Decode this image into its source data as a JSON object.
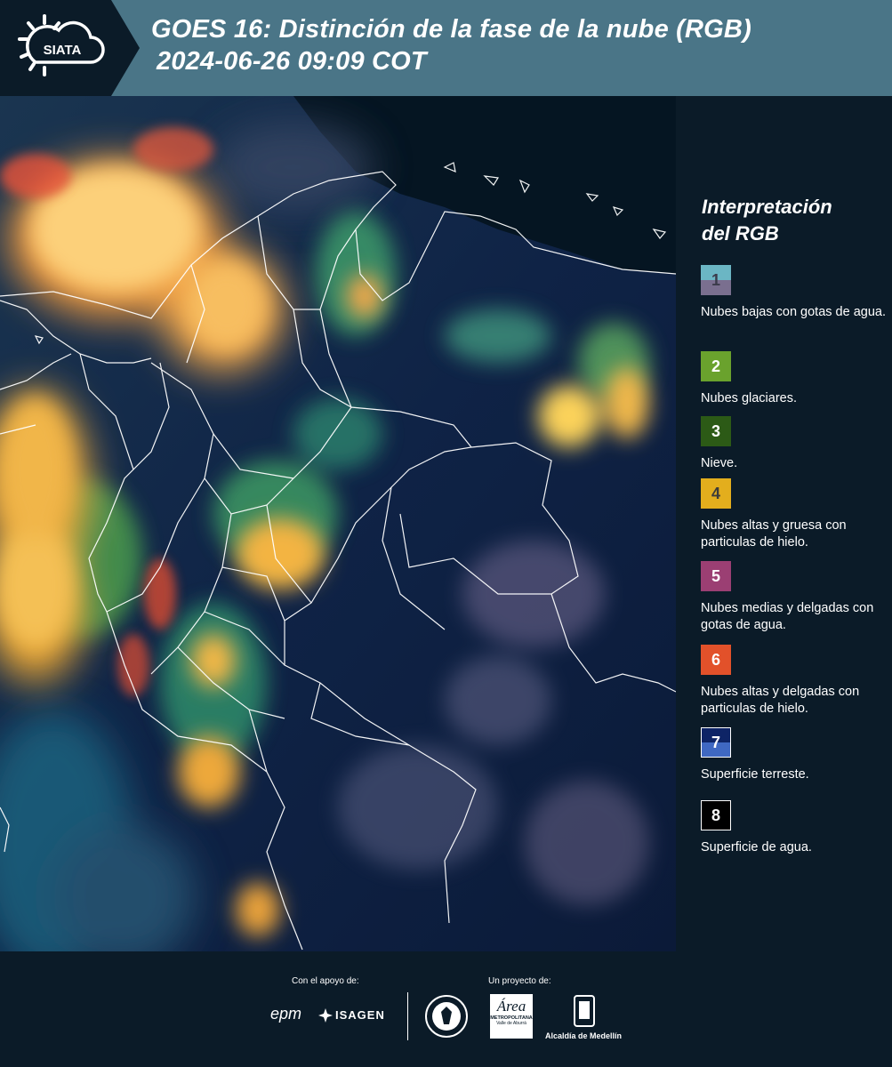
{
  "header": {
    "logo_text": "SIATA",
    "title_line1": "GOES 16: Distinción de la fase de la nube (RGB)",
    "title_line2": "2024-06-26 09:09 COT"
  },
  "legend": {
    "title_line1": "Interpretación",
    "title_line2": "del RGB",
    "items": [
      {
        "number": "1",
        "label": "Nubes bajas con gotas de agua.",
        "color_top": "#6bb6c4",
        "color_bottom": "#7a6f8f",
        "text_color": "#3b3b4a"
      },
      {
        "number": "2",
        "label": "Nubes glaciares.",
        "color_top": "#6aa22d",
        "color_bottom": "#6aa22d",
        "text_color": "#ffffff"
      },
      {
        "number": "3",
        "label": "Nieve.",
        "color_top": "#2c5a16",
        "color_bottom": "#2c5a16",
        "text_color": "#ffffff"
      },
      {
        "number": "4",
        "label": "Nubes altas y gruesa con particulas de hielo.",
        "color_top": "#e3ae1d",
        "color_bottom": "#e3ae1d",
        "text_color": "#3b3b3b"
      },
      {
        "number": "5",
        "label": "Nubes medias y delgadas con gotas de agua.",
        "color_top": "#9b3f73",
        "color_bottom": "#9b3f73",
        "text_color": "#ffffff"
      },
      {
        "number": "6",
        "label": "Nubes altas y delgadas con particulas de hielo.",
        "color_top": "#e2512a",
        "color_bottom": "#e2512a",
        "text_color": "#ffffff"
      },
      {
        "number": "7",
        "label": "Superficie terreste.",
        "color_top": "#0e2466",
        "color_bottom": "#3f68c2",
        "text_color": "#ffffff"
      },
      {
        "number": "8",
        "label": "Superficie de agua.",
        "color_top": "#000000",
        "color_bottom": "#000000",
        "text_color": "#ffffff"
      }
    ]
  },
  "footer": {
    "support_label": "Con el apoyo de:",
    "project_label": "Un proyecto de:",
    "sponsor_1": "epm",
    "sponsor_2": "ISAGEN",
    "partner_area_1": "Área",
    "partner_area_2": "METROPOLITANA",
    "partner_area_3": "Valle de Aburrá",
    "partner_3": "Alcaldía de Medellín"
  }
}
